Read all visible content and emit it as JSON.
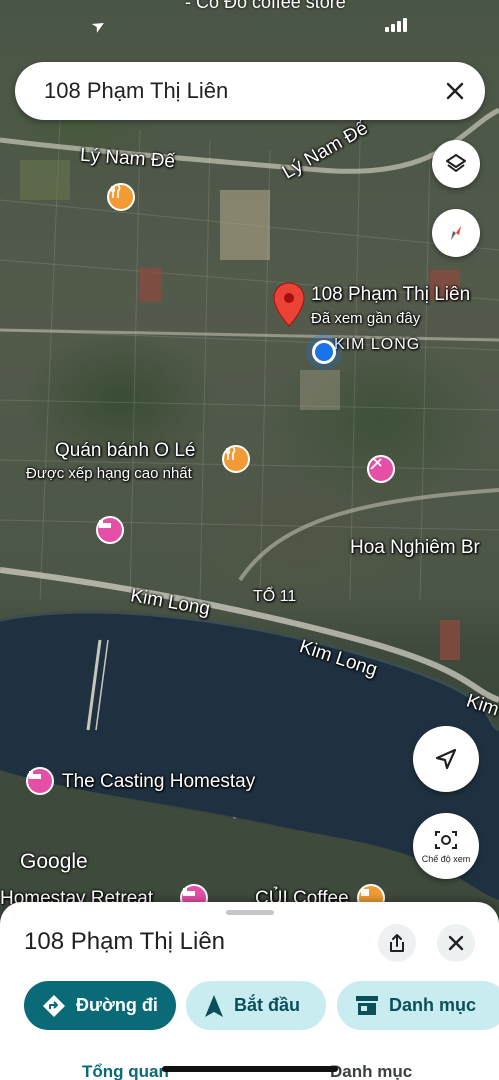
{
  "status": {
    "top_text": "- Cỏ Đỏ coffee store"
  },
  "search": {
    "query": "108 Phạm Thị Liên"
  },
  "map": {
    "labels": {
      "street_ly_nam_de_1": "Lý Nam Đế",
      "street_ly_nam_de_2": "Lý Nam Đế",
      "pin_title": "108 Phạm Thị Liên",
      "pin_subtitle": "Đã xem gần đây",
      "kim_long_area": "KIM LONG",
      "restaurant_name": "Quán bánh O Lé",
      "restaurant_sub": "Được xếp hạng cao nhất",
      "hoa_nghiem": "Hoa Nghiêm Br",
      "street_kim_long_1": "Kim Long",
      "street_kim_long_2": "Kim Long",
      "street_kim_long_3": "Kim",
      "to_11": "TỔ 11",
      "casting_homestay": "The Casting Homestay",
      "homestay_retreat": "Homestay Retreat",
      "cui_coffee": "CỦI Coffee",
      "google": "Google"
    },
    "mode_label": "Chế độ xem",
    "icons": {
      "layers": "layers-icon",
      "compass": "compass-icon",
      "locate": "navigation-arrow-icon",
      "camera": "camera-view-icon"
    }
  },
  "sheet": {
    "title": "108 Phạm Thị Liên",
    "chips": {
      "directions": "Đường đi",
      "start": "Bắt đầu",
      "category": "Danh mục"
    },
    "tabs": {
      "overview": "Tổng quan",
      "category": "Danh mục"
    }
  },
  "colors": {
    "primary": "#0b6a77",
    "chip_secondary": "#c8ecf0",
    "pin": "#ea4335",
    "poi_food": "#f29b34",
    "poi_hotel": "#e64fa6",
    "my_location": "#1a73e8"
  }
}
